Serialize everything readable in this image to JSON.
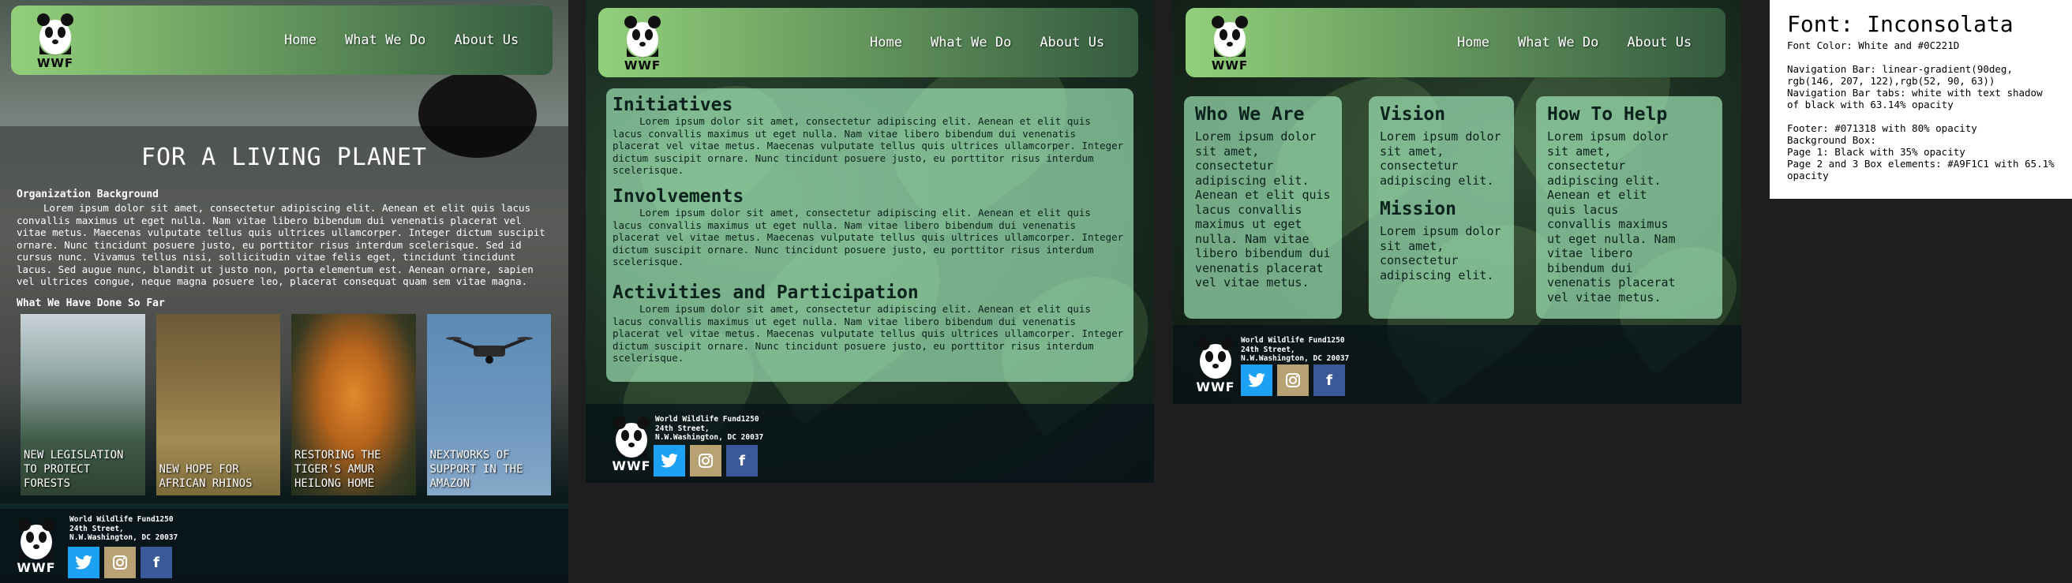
{
  "nav": {
    "logo_text": "WWF",
    "links": [
      "Home",
      "What We Do",
      "About Us"
    ]
  },
  "page1": {
    "hero_title": "FOR A LIVING PLANET",
    "section_org": "Organization Background",
    "org_body": "Lorem ipsum dolor sit amet, consectetur adipiscing elit. Aenean et elit quis lacus convallis maximus ut eget nulla. Nam vitae libero bibendum dui venenatis placerat vel vitae metus. Maecenas vulputate tellus quis ultrices ullamcorper. Integer dictum suscipit ornare. Nunc tincidunt posuere justo, eu porttitor risus interdum scelerisque. Sed id cursus nunc. Vivamus tellus nisi, sollicitudin vitae felis eget, tincidunt tincidunt lacus. Sed augue nunc, blandit ut justo non, porta elementum est. Aenean ornare, sapien vel ultrices congue, neque magna posuere leo, placerat consequat quam sem vitae magna.",
    "section_done": "What We Have Done So Far",
    "cards": [
      {
        "caption": "NEW LEGISLATION TO PROTECT FORESTS"
      },
      {
        "caption": "NEW HOPE FOR AFRICAN RHINOS"
      },
      {
        "caption": "RESTORING THE TIGER'S AMUR HEILONG HOME"
      },
      {
        "caption": "NEXTWORKS OF SUPPORT IN THE AMAZON"
      }
    ]
  },
  "page2": {
    "sections": [
      {
        "title": "Initiatives",
        "body": "Lorem ipsum dolor sit amet, consectetur adipiscing elit. Aenean et elit quis lacus convallis maximus ut eget nulla. Nam vitae libero bibendum dui venenatis placerat vel vitae metus. Maecenas vulputate tellus quis ultrices ullamcorper. Integer dictum suscipit ornare. Nunc tincidunt posuere justo, eu porttitor risus interdum scelerisque."
      },
      {
        "title": "Involvements",
        "body": "Lorem ipsum dolor sit amet, consectetur adipiscing elit. Aenean et elit quis lacus convallis maximus ut eget nulla. Nam vitae libero bibendum dui venenatis placerat vel vitae metus. Maecenas vulputate tellus quis ultrices ullamcorper. Integer dictum suscipit ornare. Nunc tincidunt posuere justo, eu porttitor risus interdum scelerisque."
      },
      {
        "title": "Activities and Participation",
        "body": "Lorem ipsum dolor sit amet, consectetur adipiscing elit. Aenean et elit quis lacus convallis maximus ut eget nulla. Nam vitae libero bibendum dui venenatis placerat vel vitae metus. Maecenas vulputate tellus quis ultrices ullamcorper. Integer dictum suscipit ornare. Nunc tincidunt posuere justo, eu porttitor risus interdum scelerisque."
      }
    ]
  },
  "page3": {
    "who": {
      "title": "Who We Are",
      "body": "Lorem ipsum dolor sit amet, consectetur adipiscing elit. Aenean et elit quis lacus convallis maximus ut eget nulla. Nam vitae libero bibendum dui venenatis placerat vel vitae metus."
    },
    "vision": {
      "title": "Vision",
      "body": "Lorem ipsum dolor sit amet, consectetur adipiscing elit."
    },
    "mission": {
      "title": "Mission",
      "body": "Lorem ipsum dolor sit amet, consectetur adipiscing elit."
    },
    "help": {
      "title": "How To Help",
      "body": "Lorem ipsum dolor sit amet, consectetur adipiscing elit. Aenean et elit quis lacus convallis maximus ut eget nulla. Nam vitae libero bibendum dui venenatis placerat vel vitae metus."
    }
  },
  "footer": {
    "logo_text": "WWF",
    "address_line1": "World Wildlife Fund1250",
    "address_line2": "24th Street,",
    "address_line3": "N.W.Washington, DC 20037",
    "twitter_icon": "twitter-bird-icon",
    "instagram_icon": "instagram-icon",
    "facebook_glyph": "f"
  },
  "notes": {
    "title": "Font: Inconsolata",
    "body": "Font Color: White and #0C221D\n\nNavigation Bar: linear-gradient(90deg,\nrgb(146, 207, 122),rgb(52, 90, 63))\nNavigation Bar tabs: white with text shadow\nof black with 63.14% opacity\n\nFooter: #071318 with 80% opacity\nBackground Box:\nPage 1: Black with 35% opacity\nPage 2 and 3 Box elements: #A9F1C1 with 65.1%\nopacity"
  },
  "colors": {
    "nav_start": "#92CF7A",
    "nav_end": "#345A3F",
    "dark_text": "#0C221D",
    "footer": "#071318",
    "box": "#A9F1C1",
    "twitter": "#1DA1F2",
    "instagram": "#B8A274",
    "facebook": "#3B5998"
  }
}
